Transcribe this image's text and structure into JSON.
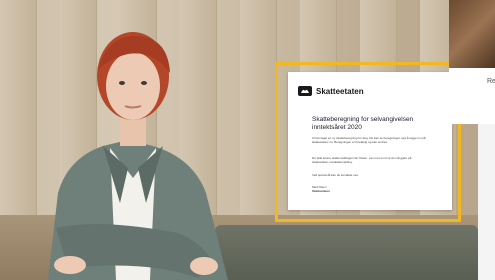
{
  "letter": {
    "brand": "Skatteetaten",
    "title_line1": "Skatteberegning for selvangivelsen",
    "title_line2": "inntektsåret 2020",
    "para1": "Vi har laget en ny skatteberegning for deg. Du kan se beregningen ved å logge inn på skatteetaten.no. Beregningen er foreløpig og kan endres.",
    "para2": "Du skal levere skattemeldingen før fristen. Les mer om hva du må gjøre på skatteetaten.no/skattemelding.",
    "para3": "Ved spørsmål kan du kontakte oss.",
    "sign1": "Med hilsen",
    "sign2": "Skatteetaten"
  },
  "right_card": {
    "text": "Re"
  },
  "colors": {
    "frame": "#f2b81f"
  }
}
